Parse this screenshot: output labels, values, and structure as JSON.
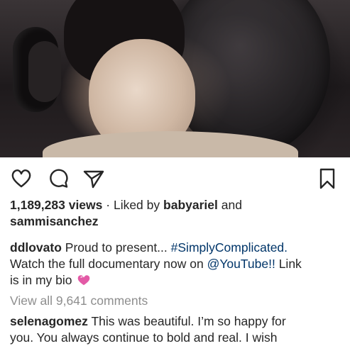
{
  "post": {
    "views": "1,189,283 views",
    "liked_prefix": "· Liked by",
    "liked_user1": "babyariel",
    "liked_and": "and",
    "liked_user2": "sammisanchez"
  },
  "caption": {
    "username": "ddlovato",
    "text1": "Proud to present...",
    "hashtag": "#SimplyComplicated.",
    "text2": "Watch the full documentary now on",
    "mention": "@YouTube!!",
    "text3": "Link",
    "text4": "is in my bio",
    "emoji": "heart-emoji"
  },
  "view_all_comments": "View all 9,641 comments",
  "comment": {
    "username": "selenagomez",
    "line1": "This was beautiful. I’m so happy for",
    "line2": "you. You always continue to bold and real. I wish"
  },
  "icons": {
    "like": "heart-icon",
    "comment": "comment-icon",
    "share": "share-icon",
    "save": "bookmark-icon"
  },
  "colors": {
    "text": "#262626",
    "link": "#003569",
    "muted": "#8e8e8e",
    "emoji_pink": "#e35aa6"
  }
}
